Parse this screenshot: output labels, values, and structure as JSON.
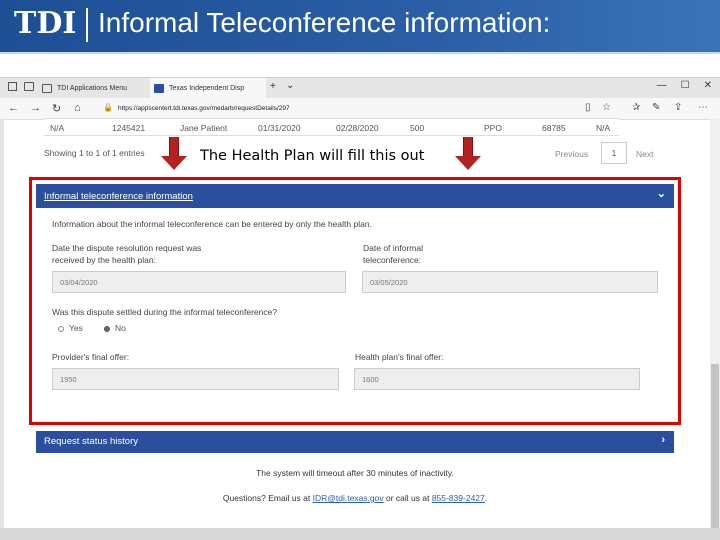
{
  "slide": {
    "logo": "TDI",
    "title": "Informal Teleconference information:"
  },
  "browser": {
    "tabs": [
      {
        "label": "TDI Applications Menu"
      },
      {
        "label": "Texas Independent Disp"
      }
    ],
    "new_tab": "+",
    "tab_menu": "⌄",
    "window_controls": [
      "—",
      "☐",
      "✕"
    ],
    "url": "https://appscentert.tdi.texas.gov/medarb/requestDetails/297"
  },
  "table": {
    "row": [
      "N/A",
      "1245421",
      "Jane Patient",
      "01/31/2020",
      "02/28/2020",
      "500",
      "PPO",
      "68785",
      "N/A"
    ]
  },
  "pager": {
    "info": "Showing 1 to 1 of 1 entries",
    "previous": "Previous",
    "page": "1",
    "next": "Next"
  },
  "callout": "The Health Plan will fill this out",
  "panel": {
    "title": "Informal teleconference information",
    "info": "Information about the informal teleconference can be entered by only the health plan.",
    "dispute_date_label_1": "Date the dispute resolution request was",
    "dispute_date_label_2": "received by the health plan:",
    "dispute_date_value": "03/04/2020",
    "teleconf_date_label_1": "Date of informal",
    "teleconf_date_label_2": "teleconference:",
    "teleconf_date_value": "03/05/2020",
    "settled_question": "Was this dispute settled during the informal teleconference?",
    "settled_yes": "Yes",
    "settled_no": "No",
    "provider_offer_label": "Provider's final offer:",
    "provider_offer_value": "1950",
    "plan_offer_label": "Health plan's final offer:",
    "plan_offer_value": "1600"
  },
  "status_history": {
    "title": "Request status history"
  },
  "footer": {
    "timeout": "The system will timeout after 30 minutes of inactivity.",
    "questions_prefix": "Questions? Email us at ",
    "email": "IDR@tdi.texas.gov",
    "questions_middle": " or call us at ",
    "phone": "855-839-2427",
    "questions_suffix": "."
  }
}
